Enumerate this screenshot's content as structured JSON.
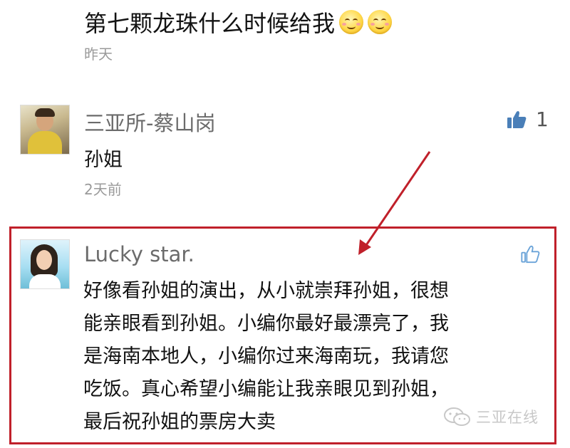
{
  "comments": [
    {
      "text": "第七颗龙珠什么时候给我",
      "emojis": [
        "smiling-face-icon",
        "smiling-face-icon"
      ],
      "time": "昨天"
    },
    {
      "name": "三亚所-蔡山岗",
      "text": "孙姐",
      "time": "2天前",
      "likes": "1"
    },
    {
      "name": "Lucky star.",
      "lines": [
        "好像看孙姐的演出，从小就崇拜孙姐，很想",
        "能亲眼看到孙姐。小编你最好最漂亮了，我",
        "是海南本地人，小编你过来海南玩，我请您",
        "吃饭。真心希望小编能让我亲眼见到孙姐，",
        "最后祝孙姐的票房大卖"
      ]
    }
  ],
  "watermark": {
    "text": "三亚在线",
    "icon": "wechat-icon"
  },
  "colors": {
    "highlight": "#c0202a",
    "like_active": "#4a7fb8",
    "like_inactive": "#6aa3d8"
  }
}
